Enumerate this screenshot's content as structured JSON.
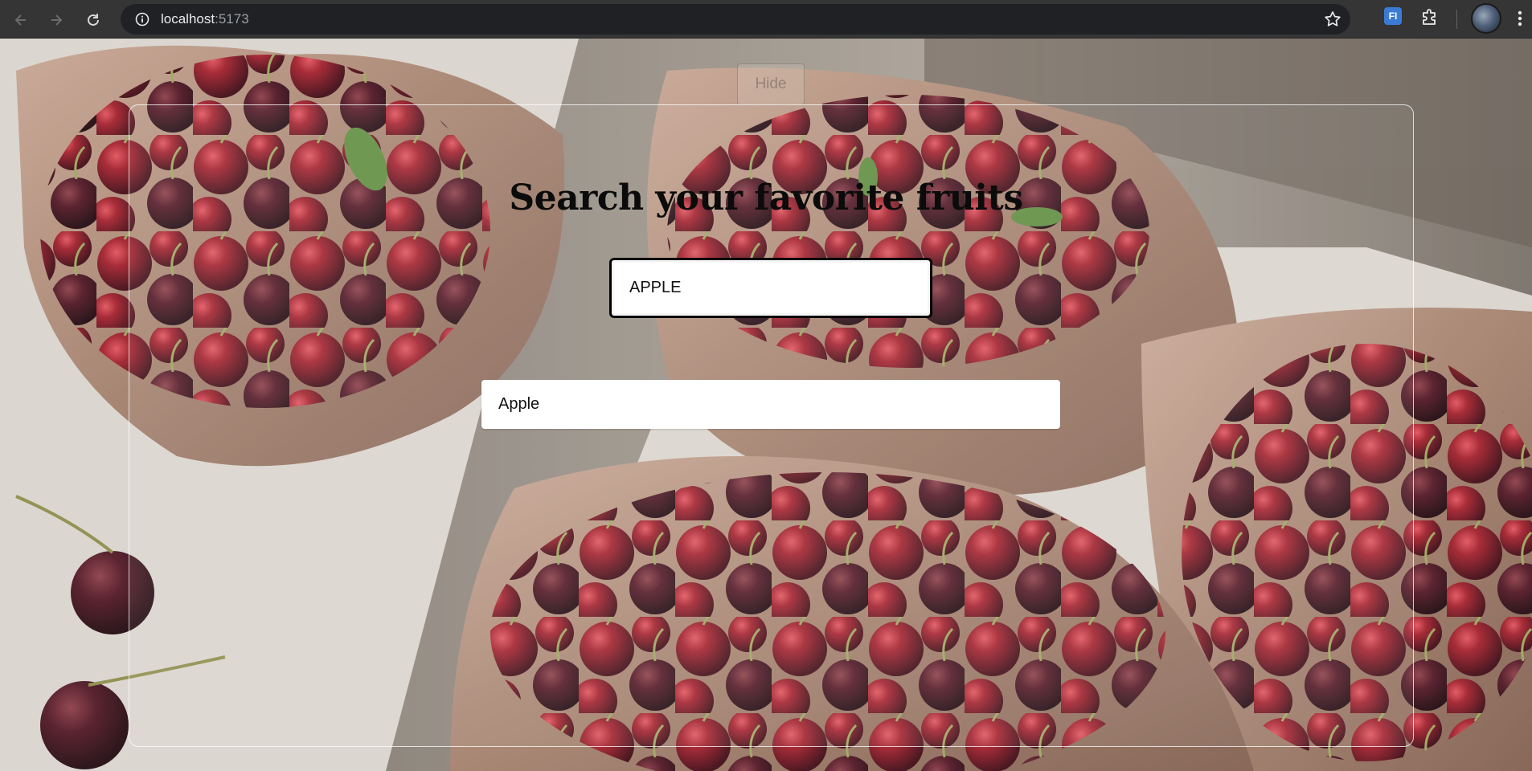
{
  "browser": {
    "url_host": "localhost",
    "url_port": ":5173",
    "extension_label": "FI"
  },
  "page": {
    "hide_label": "Hide",
    "title": "Search your favorite fruits",
    "search_value": "APPLE",
    "results": [
      "Apple"
    ]
  },
  "colors": {
    "chrome_bar": "#353535",
    "omnibox": "#202124",
    "title_text": "#0b0b0b",
    "cherry_red": "#8e1a24",
    "paper_bag": "#a9836c"
  }
}
